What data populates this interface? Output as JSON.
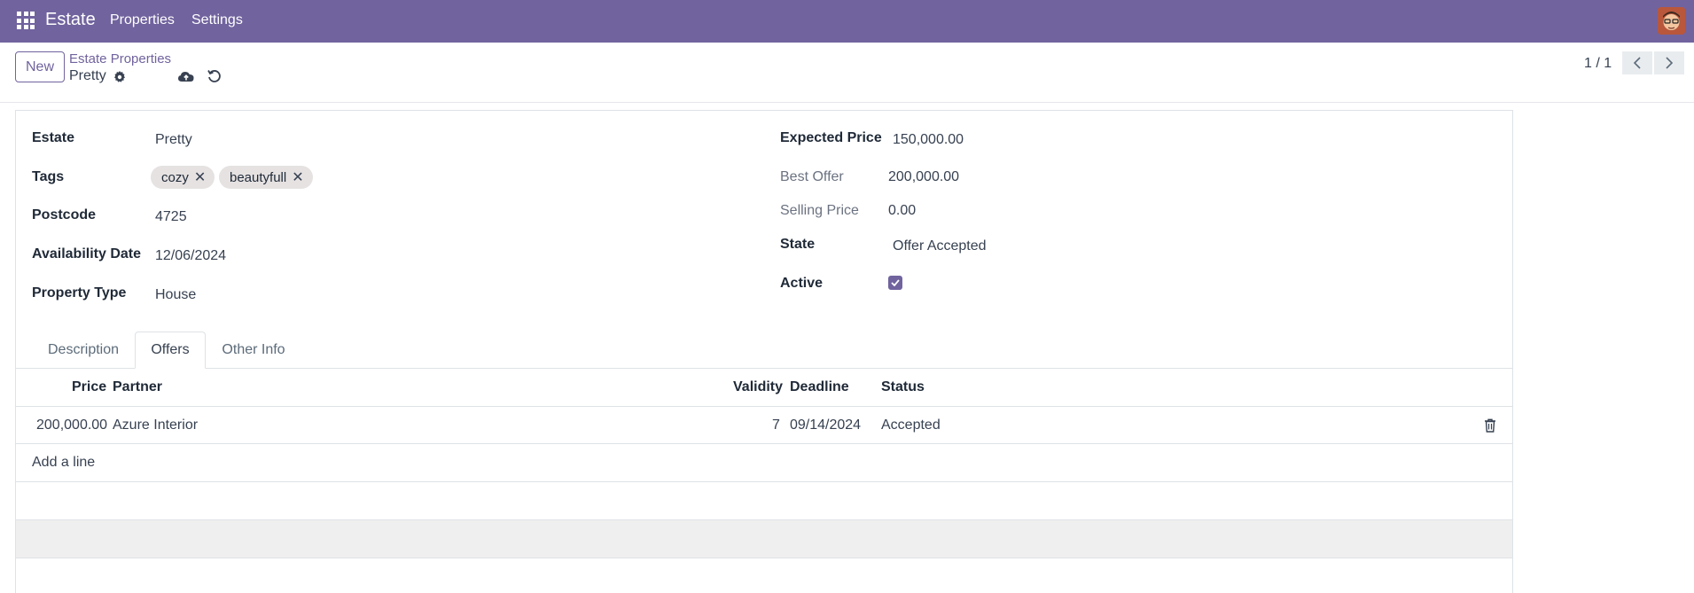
{
  "navbar": {
    "brand": "Estate",
    "menus": [
      "Properties",
      "Settings"
    ],
    "icons": {
      "apps": "apps-grid-icon",
      "avatar": "user-avatar"
    },
    "color": "#71639e"
  },
  "control_panel": {
    "new_label": "New",
    "breadcrumb_parent": "Estate Properties",
    "breadcrumb_current": "Pretty",
    "pager": "1 / 1"
  },
  "form": {
    "left": {
      "estate_label": "Estate",
      "estate_value": "Pretty",
      "tags_label": "Tags",
      "tags": [
        "cozy",
        "beautyfull"
      ],
      "postcode_label": "Postcode",
      "postcode_value": "4725",
      "availability_label": "Availability Date",
      "availability_value": "12/06/2024",
      "property_type_label": "Property Type",
      "property_type_value": "House"
    },
    "right": {
      "expected_price_label": "Expected Price",
      "expected_price_value": "150,000.00",
      "best_offer_label": "Best Offer",
      "best_offer_value": "200,000.00",
      "selling_price_label": "Selling Price",
      "selling_price_value": "0.00",
      "state_label": "State",
      "state_value": "Offer Accepted",
      "active_label": "Active",
      "active_checked": true
    }
  },
  "tabs": [
    {
      "label": "Description",
      "active": false
    },
    {
      "label": "Offers",
      "active": true
    },
    {
      "label": "Other Info",
      "active": false
    }
  ],
  "offers_table": {
    "columns": [
      "Price",
      "Partner",
      "Validity",
      "Deadline",
      "Status"
    ],
    "rows": [
      {
        "price": "200,000.00",
        "partner": "Azure Interior",
        "validity": "7",
        "deadline": "09/14/2024",
        "status": "Accepted"
      }
    ],
    "add_line_label": "Add a line"
  }
}
